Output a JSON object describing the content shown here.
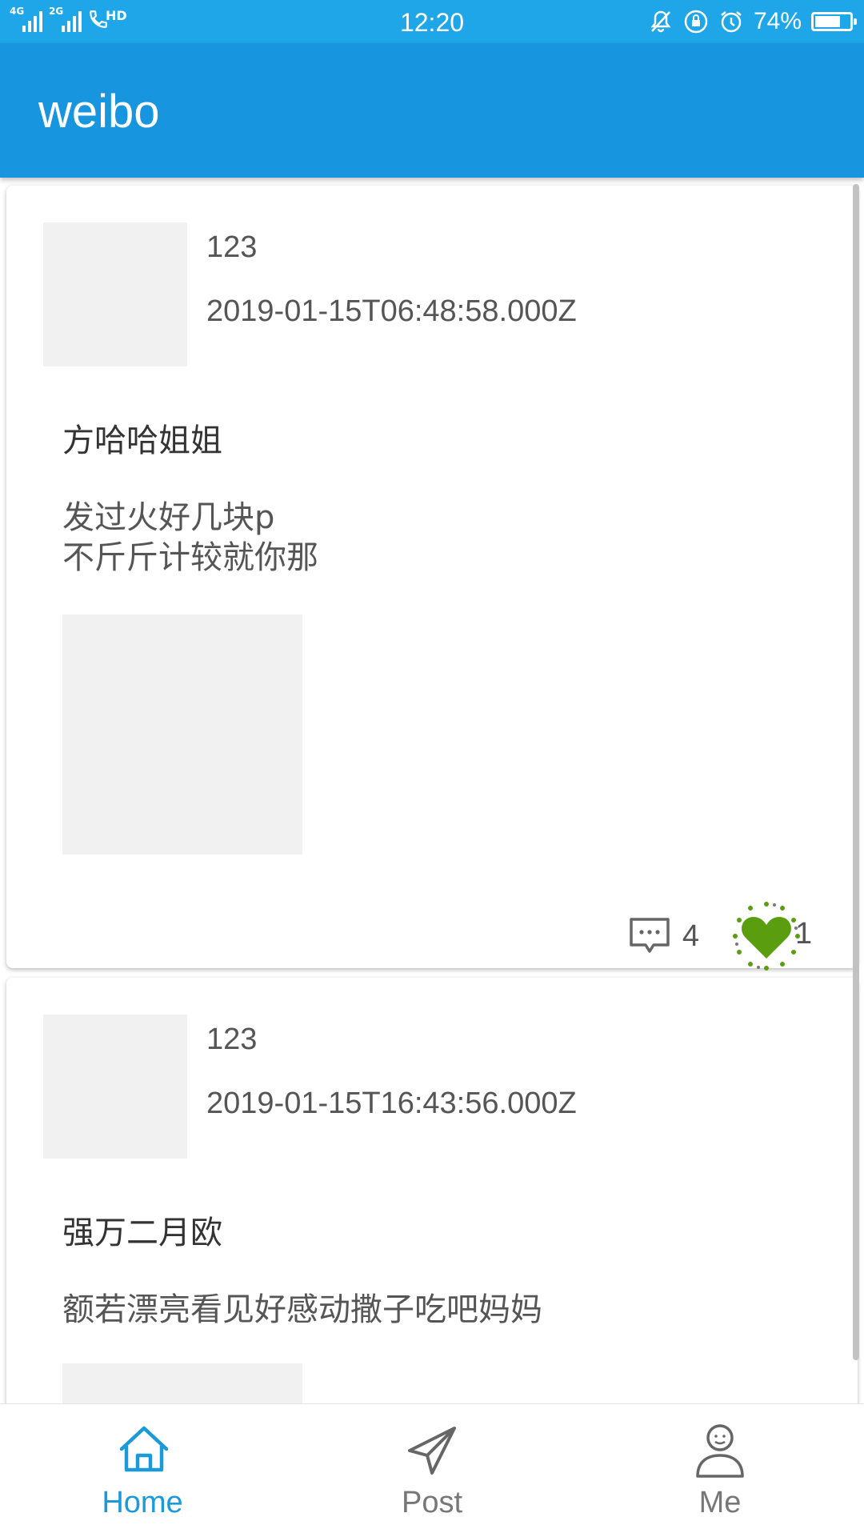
{
  "status_bar": {
    "sim1_tag": "4G",
    "sim2_tag": "2G",
    "call_tag": "HD",
    "time": "12:20",
    "battery_percent_text": "74%",
    "battery_level": 0.74
  },
  "app_bar": {
    "title": "weibo"
  },
  "posts": [
    {
      "username": "123",
      "timestamp": "2019-01-15T06:48:58.000Z",
      "title": "方哈哈姐姐",
      "body": "发过火好几块p\n不斤斤计较就你那",
      "comments": "4",
      "likes": "1",
      "liked": true
    },
    {
      "username": "123",
      "timestamp": "2019-01-15T16:43:56.000Z",
      "title": "强万二月欧",
      "body": "额若漂亮看见好感动撒子吃吧妈妈"
    }
  ],
  "bottom_nav": [
    {
      "label": "Home",
      "icon": "home-icon",
      "active": true
    },
    {
      "label": "Post",
      "icon": "send-icon",
      "active": false
    },
    {
      "label": "Me",
      "icon": "user-icon",
      "active": false
    }
  ],
  "colors": {
    "status_bar": "#1ea6e9",
    "app_bar": "#1795de",
    "active_tab": "#1a9ad9",
    "like_green": "#5a9e0f",
    "placeholder_gray": "#f1f1f1"
  }
}
